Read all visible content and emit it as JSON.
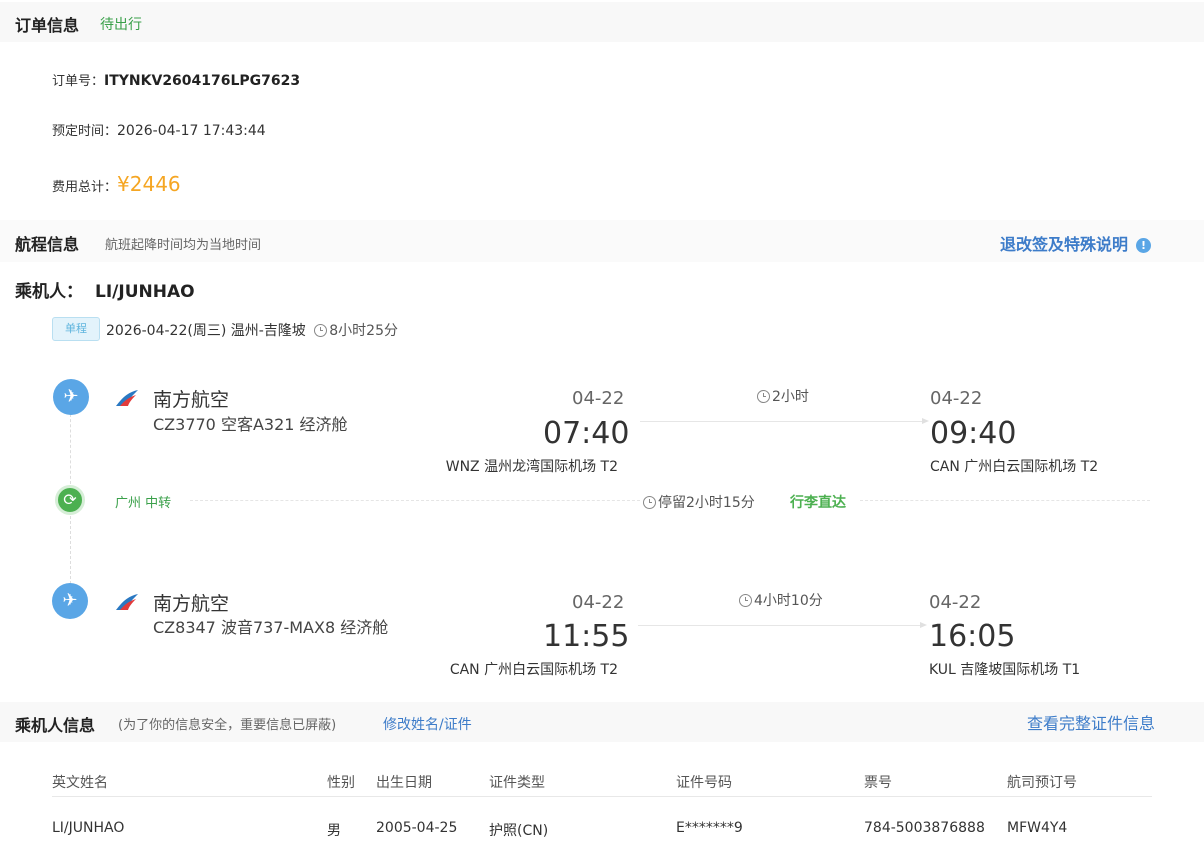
{
  "order": {
    "section_title": "订单信息",
    "status": "待出行",
    "order_no_label": "订单号：",
    "order_no": "ITYNKV2604176LPG7623",
    "booking_time_label": "预定时间：",
    "booking_time": "2026-04-17 17:43:44",
    "total_label": "费用总计：",
    "total": "¥2446"
  },
  "itinerary": {
    "section_title": "航程信息",
    "note": "航班起降时间均为当地时间",
    "rules_link": "退改签及特殊说明",
    "info_glyph": "!",
    "passenger_label": "乘机人：",
    "passenger_name": "LI/JUNHAO",
    "trip_type": "单程",
    "trip_summary": "2026-04-22(周三) 温州-吉隆坡",
    "trip_duration": "8小时25分",
    "segments": [
      {
        "airline": "南方航空",
        "flight": "CZ3770 空客A321 经济舱",
        "dep_date": "04-22",
        "dep_time": "07:40",
        "dep_airport": "WNZ 温州龙湾国际机场 T2",
        "duration": "2小时",
        "arr_date": "04-22",
        "arr_time": "09:40",
        "arr_airport": "CAN 广州白云国际机场 T2"
      },
      {
        "airline": "南方航空",
        "flight": "CZ8347 波音737-MAX8 经济舱",
        "dep_date": "04-22",
        "dep_time": "11:55",
        "dep_airport": "CAN 广州白云国际机场 T2",
        "duration": "4小时10分",
        "arr_date": "04-22",
        "arr_time": "16:05",
        "arr_airport": "KUL 吉隆坡国际机场 T1"
      }
    ],
    "transfer": {
      "city": "广州 中转",
      "stay": "停留2小时15分",
      "baggage": "行李直达"
    }
  },
  "passengers": {
    "section_title": "乘机人信息",
    "note": "(为了你的信息安全，重要信息已屏蔽)",
    "edit_link": "修改姓名/证件",
    "view_link": "查看完整证件信息",
    "columns": [
      "英文姓名",
      "性别",
      "出生日期",
      "证件类型",
      "证件号码",
      "票号",
      "航司预订号"
    ],
    "rows": [
      [
        "LI/JUNHAO",
        "男",
        "2005-04-25",
        "护照(CN)",
        "E*******9",
        "784-5003876888",
        "MFW4Y4"
      ]
    ]
  },
  "colors": {
    "status_green": "#3aa04a",
    "price_orange": "#f5a623",
    "link_blue": "#3d7cc9",
    "plane_circle": "#5aa6e6",
    "transfer_circle": "#4cb050"
  },
  "icons": {
    "segment_icon": "plane-takeoff-icon",
    "transfer_icon": "transfer-cycle-icon",
    "airline_icon": "china-southern-logo-icon",
    "duration_icon": "clock-icon"
  }
}
